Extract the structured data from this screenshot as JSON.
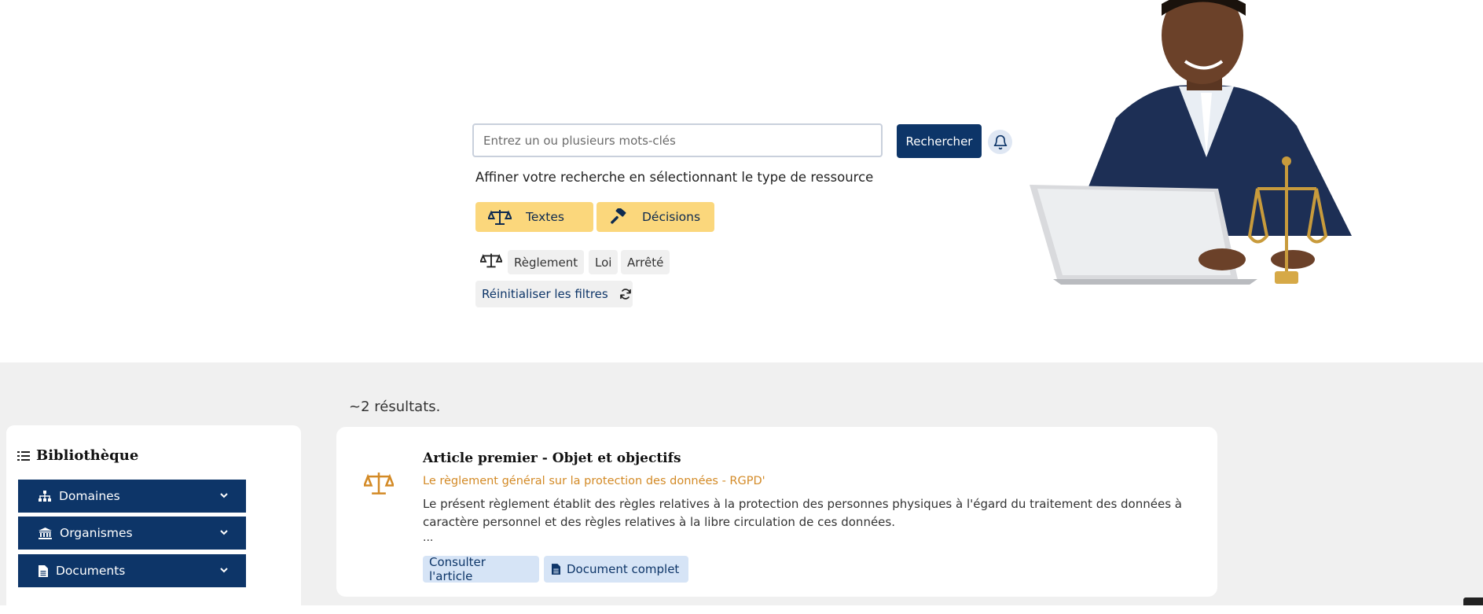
{
  "search": {
    "placeholder": "Entrez un ou plusieurs mots-clés",
    "button_label": "Rechercher"
  },
  "filters": {
    "refine_text": "Affiner votre recherche en sélectionnant le type de ressource",
    "types": [
      {
        "label": "Textes",
        "icon": "scale-icon"
      },
      {
        "label": "Décisions",
        "icon": "gavel-icon"
      }
    ],
    "chips": [
      "Règlement",
      "Loi",
      "Arrêté"
    ],
    "reset_label": "Réinitialiser les filtres"
  },
  "results": {
    "count_text": "~2 résultats."
  },
  "sidebar": {
    "title": "Bibliothèque",
    "items": [
      {
        "label": "Domaines",
        "icon": "sitemap-icon"
      },
      {
        "label": "Organismes",
        "icon": "institution-icon"
      },
      {
        "label": "Documents",
        "icon": "document-icon"
      }
    ]
  },
  "card": {
    "title": "Article premier - Objet et objectifs",
    "subtitle": "Le règlement général sur la protection des données - RGPD'",
    "text": "Le présent règlement établit des règles relatives à la protection des personnes physiques à l'égard du traitement des données à caractère personnel et des règles relatives à la libre circulation de ces données.",
    "ellipsis": "...",
    "buttons": {
      "consult": "Consulter l'article",
      "full_document": "Document complet"
    }
  },
  "colors": {
    "primary": "#0d3568",
    "accent_yellow": "#fbd77c",
    "accent_orange": "#d38a26",
    "light_blue": "#d6e4f6",
    "page_gray": "#f0f0f0"
  }
}
